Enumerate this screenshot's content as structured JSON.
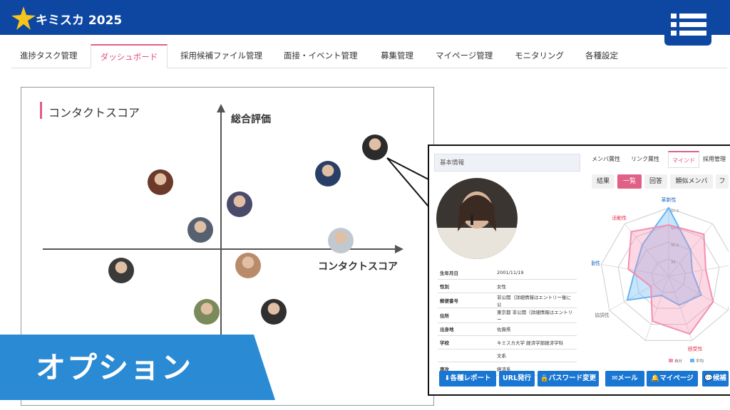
{
  "app": {
    "title": "キミスカ 2025"
  },
  "nav": {
    "tabs": [
      {
        "label": "進捗タスク管理"
      },
      {
        "label": "ダッシュボード"
      },
      {
        "label": "採用候補ファイル管理"
      },
      {
        "label": "面接・イベント管理"
      },
      {
        "label": "募集管理"
      },
      {
        "label": "マイページ管理"
      },
      {
        "label": "モニタリング"
      },
      {
        "label": "各種設定"
      }
    ],
    "active_index": 1
  },
  "scatter": {
    "title": "コンタクトスコア",
    "y_axis_label": "総合評価",
    "x_axis_label": "コンタクトスコア",
    "avatar_colors": [
      "#2b2b2b",
      "#6b3a2a",
      "#2a3f66",
      "#4a4a6a",
      "#556070",
      "#c2c8d0",
      "#3a3a3a",
      "#b88c6a",
      "#7a8a5a",
      "#303030"
    ]
  },
  "detail": {
    "basic_info_title": "基本情報",
    "attr_tabs": [
      "メンバ属性",
      "リンク属性",
      "マインド",
      "採用管理"
    ],
    "attr_active_index": 2,
    "sub_tabs": [
      "結果",
      "一覧",
      "回答",
      "類似メンバ",
      "フ"
    ],
    "sub_active_index": 1,
    "info_rows": [
      {
        "key": "生年月日",
        "value": "2001/11/19"
      },
      {
        "key": "性別",
        "value": "女性"
      },
      {
        "key": "郵便番号",
        "value": "非公開（詳細情報はエントリー後に公"
      },
      {
        "key": "住所",
        "value": "東京都 非公開（詳細情報はエントリー"
      },
      {
        "key": "出身地",
        "value": "佐賀県"
      },
      {
        "key": "学校",
        "value": "キミスカ大学 経済学部経済学科"
      },
      {
        "key": "",
        "value": "文系"
      },
      {
        "key": "専攻",
        "value": "経済系"
      }
    ],
    "radar": {
      "labels": [
        "革新性",
        "",
        "",
        "",
        "感受性",
        "",
        "協調性",
        "情動性",
        "活動性"
      ],
      "tick_labels": [
        "60.6",
        "51.4",
        "42.2",
        "33"
      ],
      "legend": [
        "自分",
        "平均"
      ],
      "self_color": "#f48fb1",
      "avg_color": "#64b5f6"
    },
    "buttons": [
      "各種レポート",
      "URL発行",
      "パスワード変更",
      "メール",
      "マイページ",
      "候補"
    ]
  },
  "banner": {
    "label": "オプション",
    "color": "#2a8ad4"
  }
}
